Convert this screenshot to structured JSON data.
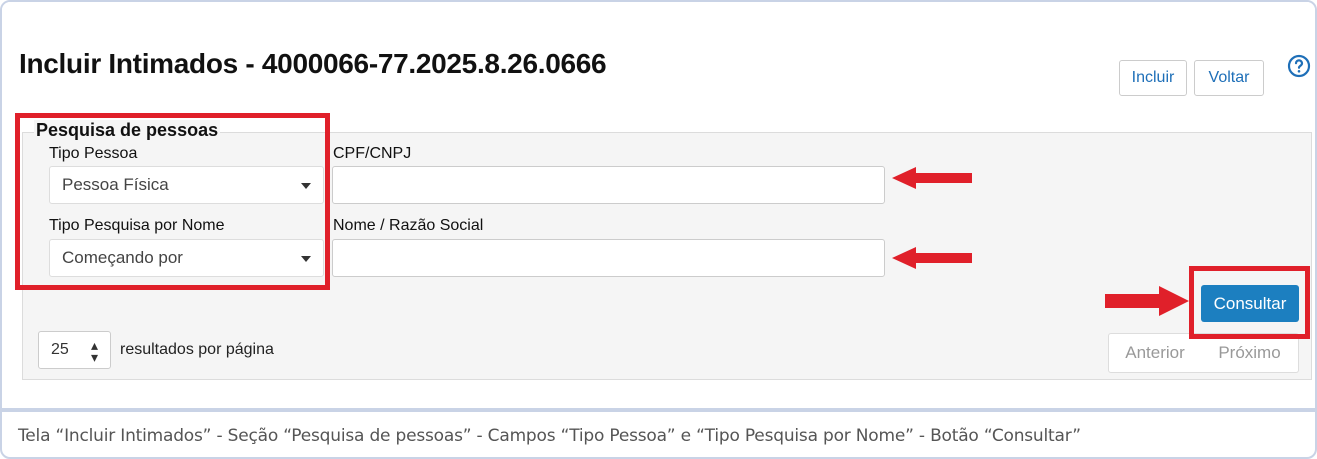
{
  "page": {
    "title": "Incluir Intimados - 4000066-77.2025.8.26.0666"
  },
  "toolbar": {
    "incluir_label": "Incluir",
    "voltar_label": "Voltar",
    "help_icon": "question-circle-icon"
  },
  "search": {
    "legend": "Pesquisa de pessoas",
    "tipo_pessoa_label": "Tipo Pessoa",
    "tipo_pessoa_value": "Pessoa Física",
    "tipo_pesquisa_label": "Tipo Pesquisa por Nome",
    "tipo_pesquisa_value": "Começando por",
    "cpf_label": "CPF/CNPJ",
    "cpf_value": "",
    "nome_label": "Nome / Razão Social",
    "nome_value": "",
    "consultar_label": "Consultar"
  },
  "results": {
    "page_size": "25",
    "page_size_suffix": "resultados por página",
    "previous_label": "Anterior",
    "next_label": "Próximo"
  },
  "caption": "Tela “Incluir Intimados” - Seção “Pesquisa de pessoas” - Campos “Tipo Pessoa” e “Tipo Pesquisa por Nome” - Botão “Consultar”",
  "colors": {
    "accent": "#1c7fc0",
    "highlight": "#e0202a",
    "frame": "#c9d3e6"
  }
}
